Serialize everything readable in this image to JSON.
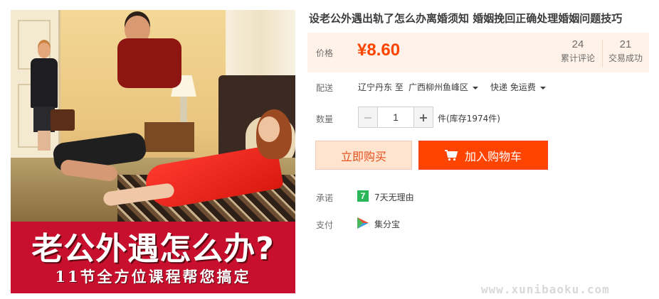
{
  "product": {
    "title": "设老公外遇出轨了怎么办离婚须知 婚姻挽回正确处理婚姻问题技巧",
    "image": {
      "banner_title": "老公外遇怎么办?",
      "banner_subtitle": "11节全方位课程帮您搞定"
    }
  },
  "price": {
    "label": "价格",
    "value": "¥8.60",
    "reviews_count": "24",
    "reviews_label": "累计评论",
    "sales_count": "21",
    "sales_label": "交易成功"
  },
  "shipping": {
    "label": "配送",
    "from": "辽宁丹东 至",
    "to": "广西柳州鱼峰区",
    "method": "快递 免运费"
  },
  "quantity": {
    "label": "数量",
    "minus": "−",
    "value": "1",
    "plus": "+",
    "stock": "件(库存1974件)"
  },
  "actions": {
    "buy_now": "立即购买",
    "add_to_cart": "加入购物车"
  },
  "promise": {
    "label": "承诺",
    "icon_text": "7",
    "text": "7天无理由"
  },
  "payment": {
    "label": "支付",
    "text": "集分宝"
  },
  "watermark": "www.xunibaoku.com",
  "colors": {
    "accent": "#ff4400",
    "price_bg": "#fff2e8",
    "buy_bg": "#ffe4d0",
    "banner_red": "#c8102e",
    "promise_green": "#2cb65a"
  }
}
